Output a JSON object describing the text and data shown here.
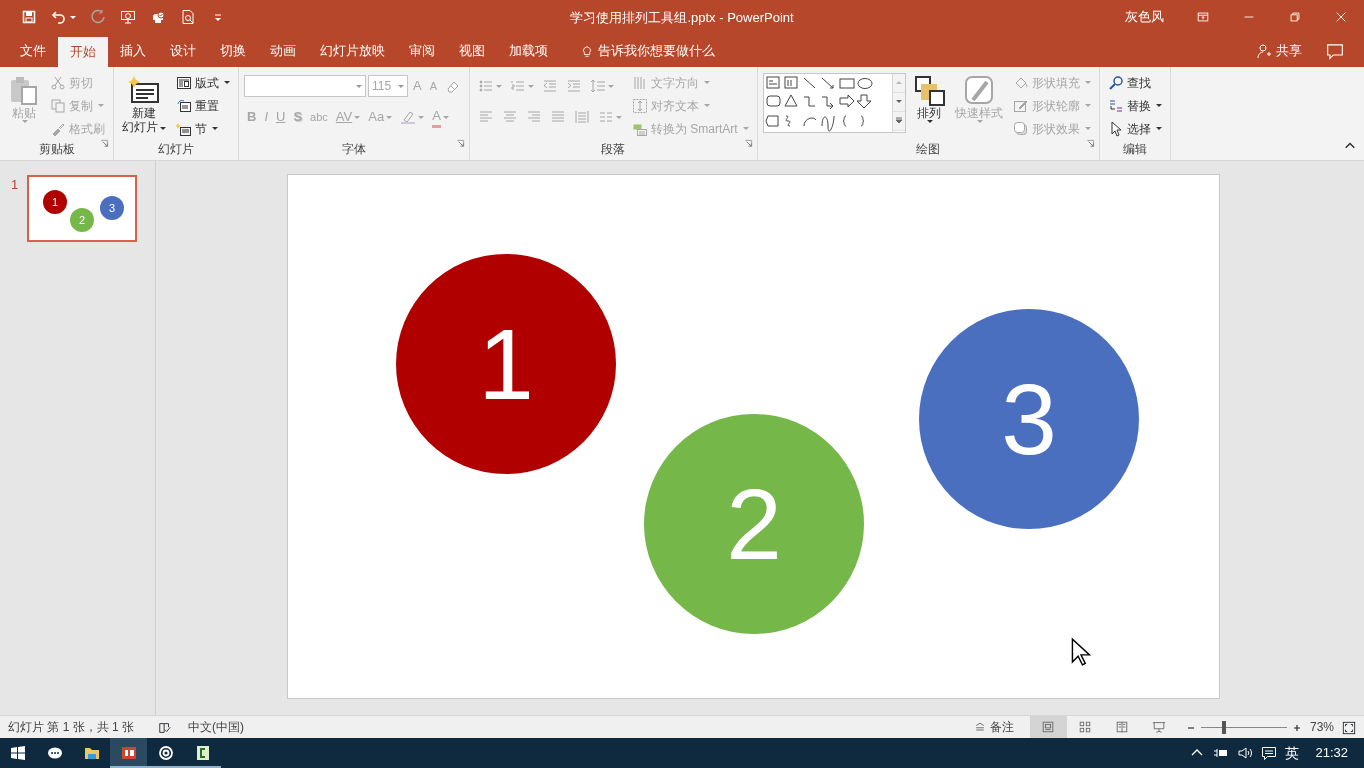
{
  "window": {
    "title": "学习使用排列工具组.pptx - PowerPoint",
    "user": "灰色风"
  },
  "quick_access": [
    {
      "kind": "save",
      "disabled": false,
      "dropdown": false
    },
    {
      "kind": "undo",
      "disabled": false,
      "dropdown": true
    },
    {
      "kind": "redo",
      "disabled": true,
      "dropdown": false
    },
    {
      "kind": "present",
      "disabled": false,
      "dropdown": false
    },
    {
      "kind": "touch",
      "disabled": false,
      "dropdown": false
    },
    {
      "kind": "preview",
      "disabled": false,
      "dropdown": false
    },
    {
      "kind": "customize",
      "disabled": false,
      "dropdown": false
    }
  ],
  "tabs": [
    {
      "label": "文件",
      "selected": false
    },
    {
      "label": "开始",
      "selected": true
    },
    {
      "label": "插入",
      "selected": false
    },
    {
      "label": "设计",
      "selected": false
    },
    {
      "label": "切换",
      "selected": false
    },
    {
      "label": "动画",
      "selected": false
    },
    {
      "label": "幻灯片放映",
      "selected": false
    },
    {
      "label": "审阅",
      "selected": false
    },
    {
      "label": "视图",
      "selected": false
    },
    {
      "label": "加载项",
      "selected": false
    }
  ],
  "tell_me": "告诉我你想要做什么",
  "share": "共享",
  "ribbon": [
    {
      "label": "剪贴板",
      "launcher": true,
      "columns": [
        {
          "kind": "big",
          "items": [
            {
              "kind": "paste",
              "label": "粘贴",
              "disabled": true,
              "dropdown": true
            }
          ]
        },
        {
          "kind": "stack",
          "items": [
            {
              "kind": "cut",
              "label": "剪切",
              "disabled": true,
              "dropdown": false
            },
            {
              "kind": "copy",
              "label": "复制",
              "disabled": true,
              "dropdown": true
            },
            {
              "kind": "painter",
              "label": "格式刷",
              "disabled": true,
              "dropdown": false
            }
          ]
        }
      ]
    },
    {
      "label": "幻灯片",
      "launcher": false,
      "columns": [
        {
          "kind": "big",
          "items": [
            {
              "kind": "newslide",
              "label": "新建",
              "label_2": "幻灯片",
              "disabled": false,
              "dropdown": true
            }
          ]
        },
        {
          "kind": "stack",
          "items": [
            {
              "kind": "layout",
              "label": "版式",
              "disabled": false,
              "dropdown": true
            },
            {
              "kind": "reset",
              "label": "重置",
              "disabled": false,
              "dropdown": false
            },
            {
              "kind": "section",
              "label": "节",
              "disabled": false,
              "dropdown": true
            }
          ]
        }
      ]
    },
    {
      "label": "字体",
      "launcher": true,
      "columns": [
        {
          "kind": "rows",
          "rows": [
            {
              "tools": [
                {
                  "kind": "fontname",
                  "disabled": true,
                  "dropdown": true
                },
                {
                  "kind": "fontsize",
                  "value": "115",
                  "disabled": true,
                  "dropdown": true
                },
                {
                  "kind": "grow",
                  "label": "A",
                  "disabled": true,
                  "dropdown": false
                },
                {
                  "kind": "shrink",
                  "label": "A",
                  "disabled": true,
                  "dropdown": false
                },
                {
                  "kind": "clearformat",
                  "disabled": true,
                  "dropdown": false
                }
              ]
            },
            {
              "tools": [
                {
                  "kind": "bold",
                  "label": "B",
                  "disabled": true,
                  "dropdown": false
                },
                {
                  "kind": "italic",
                  "label": "I",
                  "disabled": true,
                  "dropdown": false
                },
                {
                  "kind": "underline",
                  "label": "U",
                  "disabled": true,
                  "dropdown": false
                },
                {
                  "kind": "shadow",
                  "label": "S",
                  "disabled": true,
                  "dropdown": false
                },
                {
                  "kind": "strike",
                  "label": "abc",
                  "disabled": true,
                  "dropdown": false
                },
                {
                  "kind": "spacing",
                  "label": "AV",
                  "disabled": true,
                  "dropdown": true
                },
                {
                  "kind": "case",
                  "label": "Aa",
                  "disabled": true,
                  "dropdown": true
                },
                {
                  "kind": "highlight",
                  "disabled": true,
                  "dropdown": true
                },
                {
                  "kind": "fontcolor",
                  "label": "A",
                  "disabled": true,
                  "dropdown": true
                }
              ]
            }
          ]
        }
      ]
    },
    {
      "label": "段落",
      "launcher": true,
      "columns": [
        {
          "kind": "rows",
          "rows": [
            {
              "tools": [
                {
                  "kind": "bullets",
                  "disabled": true,
                  "dropdown": true
                },
                {
                  "kind": "numbering",
                  "disabled": true,
                  "dropdown": true
                },
                {
                  "kind": "outdent",
                  "disabled": true,
                  "dropdown": false
                },
                {
                  "kind": "indent",
                  "disabled": true,
                  "dropdown": false
                },
                {
                  "kind": "linespacing",
                  "disabled": true,
                  "dropdown": true
                }
              ]
            },
            {
              "tools": [
                {
                  "kind": "alignleft",
                  "disabled": true,
                  "dropdown": false
                },
                {
                  "kind": "center",
                  "disabled": true,
                  "dropdown": false
                },
                {
                  "kind": "alignright",
                  "disabled": true,
                  "dropdown": false
                },
                {
                  "kind": "justify",
                  "disabled": true,
                  "dropdown": false
                },
                {
                  "kind": "distribute",
                  "disabled": true,
                  "dropdown": false
                },
                {
                  "kind": "columns",
                  "disabled": true,
                  "dropdown": true
                }
              ]
            }
          ]
        },
        {
          "kind": "stack",
          "items": [
            {
              "kind": "textdir",
              "label": "文字方向",
              "disabled": true,
              "dropdown": true
            },
            {
              "kind": "aligntext",
              "label": "对齐文本",
              "disabled": true,
              "dropdown": true
            },
            {
              "kind": "smartart",
              "label": "转换为 SmartArt",
              "disabled": true,
              "dropdown": true
            }
          ]
        }
      ]
    },
    {
      "label": "绘图",
      "launcher": true,
      "columns": [
        {
          "kind": "gallery"
        },
        {
          "kind": "big",
          "items": [
            {
              "kind": "arrange",
              "label": "排列",
              "disabled": false,
              "dropdown": true
            },
            {
              "kind": "quickstyles",
              "label": "快速样式",
              "disabled": true,
              "dropdown": true
            }
          ]
        },
        {
          "kind": "stack",
          "items": [
            {
              "kind": "fill",
              "label": "形状填充",
              "disabled": true,
              "dropdown": true
            },
            {
              "kind": "outline",
              "label": "形状轮廓",
              "disabled": true,
              "dropdown": true
            },
            {
              "kind": "effects",
              "label": "形状效果",
              "disabled": true,
              "dropdown": true
            }
          ]
        }
      ]
    },
    {
      "label": "编辑",
      "launcher": false,
      "columns": [
        {
          "kind": "stack",
          "items": [
            {
              "kind": "find",
              "label": "查找",
              "disabled": false,
              "dropdown": false
            },
            {
              "kind": "replace",
              "label": "替换",
              "disabled": false,
              "dropdown": true
            },
            {
              "kind": "select",
              "label": "选择",
              "disabled": false,
              "dropdown": true
            }
          ]
        }
      ]
    }
  ],
  "slides_pane": [
    {
      "number": "1",
      "selected": true,
      "shapes": [
        {
          "label": "1",
          "color": "#b00000"
        },
        {
          "label": "2",
          "color": "#76b74a"
        },
        {
          "label": "3",
          "color": "#4a6fbe"
        }
      ]
    }
  ],
  "slide": {
    "shapes": [
      {
        "label": "1",
        "color": "#b00000"
      },
      {
        "label": "2",
        "color": "#76b74a"
      },
      {
        "label": "3",
        "color": "#4a6fbe"
      }
    ]
  },
  "status_bar": {
    "slide_info": "幻灯片 第 1 张，共 1 张",
    "language": "中文(中国)",
    "notes": "备注",
    "views": [
      {
        "kind": "normal",
        "selected": true
      },
      {
        "kind": "sorter",
        "selected": false
      },
      {
        "kind": "reading",
        "selected": false
      },
      {
        "kind": "slideshow",
        "selected": false
      }
    ],
    "zoom": {
      "level": 0.27,
      "reading": "73%"
    }
  },
  "taskbar": {
    "apps": [
      {
        "kind": "start",
        "running": false,
        "selected": false
      },
      {
        "kind": "assistant",
        "running": false,
        "selected": false
      },
      {
        "kind": "files",
        "running": false,
        "selected": false
      },
      {
        "kind": "powerpoint",
        "running": true,
        "selected": true
      },
      {
        "kind": "target",
        "running": true,
        "selected": false
      },
      {
        "kind": "app",
        "running": true,
        "selected": false
      }
    ],
    "ime": "英",
    "time": "21:32"
  }
}
